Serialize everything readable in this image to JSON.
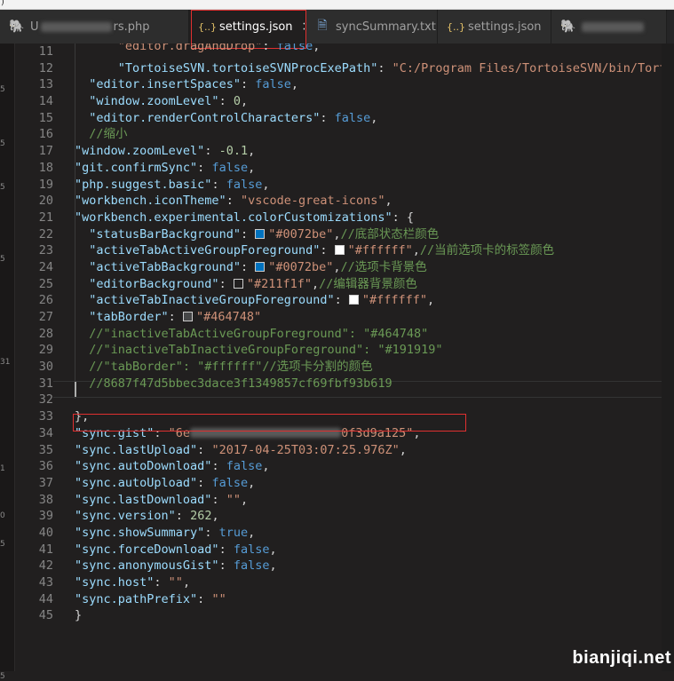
{
  "window": {
    "corner_glyph": ")"
  },
  "tabs": [
    {
      "icon": "php-elephant-icon",
      "label_start": "U",
      "label_end": "rs.php",
      "active": false
    },
    {
      "icon": "json-braces-icon",
      "label": "settings.json",
      "active": true,
      "close": "×"
    },
    {
      "icon": "text-file-icon",
      "label": "syncSummary.txt",
      "active": false
    },
    {
      "icon": "json-braces-icon",
      "label": "settings.json",
      "active": false
    },
    {
      "icon": "php-elephant-icon",
      "label": "",
      "active": false
    }
  ],
  "left_gutter_marks": [
    "5",
    "5",
    "5",
    "5",
    "31",
    "1",
    "0",
    "5",
    "5"
  ],
  "lines": [
    {
      "n": "11",
      "indent": 6,
      "t": [
        [
          "s",
          "\"editor.dragAndDrop\""
        ],
        [
          "p",
          ": "
        ],
        [
          "b",
          "false"
        ],
        [
          "p",
          ","
        ]
      ]
    },
    {
      "n": "12",
      "indent": 6,
      "t": [
        [
          "k",
          "\"TortoiseSVN.tortoiseSVNProcExePath\""
        ],
        [
          "p",
          ": "
        ],
        [
          "s",
          "\"C:/Program Files/TortoiseSVN/bin/Tortoi"
        ]
      ]
    },
    {
      "n": "13",
      "indent": 2,
      "t": [
        [
          "k",
          "\"editor.insertSpaces\""
        ],
        [
          "p",
          ": "
        ],
        [
          "b",
          "false"
        ],
        [
          "p",
          ","
        ]
      ]
    },
    {
      "n": "14",
      "indent": 2,
      "t": [
        [
          "k",
          "\"window.zoomLevel\""
        ],
        [
          "p",
          ": "
        ],
        [
          "n",
          "0"
        ],
        [
          "p",
          ","
        ]
      ]
    },
    {
      "n": "15",
      "indent": 2,
      "t": [
        [
          "k",
          "\"editor.renderControlCharacters\""
        ],
        [
          "p",
          ": "
        ],
        [
          "b",
          "false"
        ],
        [
          "p",
          ","
        ]
      ]
    },
    {
      "n": "16",
      "indent": 2,
      "t": [
        [
          "c",
          "//缩小"
        ]
      ]
    },
    {
      "n": "17",
      "indent": 0,
      "t": [
        [
          "k",
          "\"window.zoomLevel\""
        ],
        [
          "p",
          ": "
        ],
        [
          "n",
          "-0.1"
        ],
        [
          "p",
          ","
        ]
      ]
    },
    {
      "n": "18",
      "indent": 0,
      "t": [
        [
          "k",
          "\"git.confirmSync\""
        ],
        [
          "p",
          ": "
        ],
        [
          "b",
          "false"
        ],
        [
          "p",
          ","
        ]
      ]
    },
    {
      "n": "19",
      "indent": 0,
      "t": [
        [
          "k",
          "\"php.suggest.basic\""
        ],
        [
          "p",
          ": "
        ],
        [
          "b",
          "false"
        ],
        [
          "p",
          ","
        ]
      ]
    },
    {
      "n": "20",
      "indent": 0,
      "t": [
        [
          "k",
          "\"workbench.iconTheme\""
        ],
        [
          "p",
          ": "
        ],
        [
          "s",
          "\"vscode-great-icons\""
        ],
        [
          "p",
          ","
        ]
      ]
    },
    {
      "n": "21",
      "indent": 0,
      "t": [
        [
          "k",
          "\"workbench.experimental.colorCustomizations\""
        ],
        [
          "p",
          ": {"
        ]
      ]
    },
    {
      "n": "22",
      "indent": 2,
      "t": [
        [
          "k",
          "\"statusBarBackground\""
        ],
        [
          "p",
          ": "
        ],
        [
          "sw",
          "#0072be"
        ],
        [
          "s",
          "\"#0072be\""
        ],
        [
          "p",
          ","
        ],
        [
          "c",
          "//底部状态栏颜色"
        ]
      ]
    },
    {
      "n": "23",
      "indent": 2,
      "t": [
        [
          "k",
          "\"activeTabActiveGroupForeground\""
        ],
        [
          "p",
          ": "
        ],
        [
          "sw",
          "#ffffff"
        ],
        [
          "s",
          "\"#ffffff\""
        ],
        [
          "p",
          ","
        ],
        [
          "c",
          "//当前选项卡的标签颜色"
        ]
      ]
    },
    {
      "n": "24",
      "indent": 2,
      "t": [
        [
          "k",
          "\"activeTabBackground\""
        ],
        [
          "p",
          ": "
        ],
        [
          "sw",
          "#0072be"
        ],
        [
          "s",
          "\"#0072be\""
        ],
        [
          "p",
          ","
        ],
        [
          "c",
          "//选项卡背景色"
        ]
      ]
    },
    {
      "n": "25",
      "indent": 2,
      "t": [
        [
          "k",
          "\"editorBackground\""
        ],
        [
          "p",
          ": "
        ],
        [
          "sw",
          "#211f1f"
        ],
        [
          "s",
          "\"#211f1f\""
        ],
        [
          "p",
          ","
        ],
        [
          "c",
          "//编辑器背景颜色"
        ]
      ]
    },
    {
      "n": "26",
      "indent": 2,
      "t": [
        [
          "k",
          "\"activeTabInactiveGroupForeground\""
        ],
        [
          "p",
          ": "
        ],
        [
          "sw",
          "#ffffff"
        ],
        [
          "s",
          "\"#ffffff\""
        ],
        [
          "p",
          ","
        ]
      ]
    },
    {
      "n": "27",
      "indent": 2,
      "t": [
        [
          "k",
          "\"tabBorder\""
        ],
        [
          "p",
          ": "
        ],
        [
          "sw",
          "#464748"
        ],
        [
          "s",
          "\"#464748\""
        ]
      ]
    },
    {
      "n": "28",
      "indent": 2,
      "t": [
        [
          "c",
          "//\"inactiveTabActiveGroupForeground\": \"#464748\""
        ]
      ]
    },
    {
      "n": "29",
      "indent": 2,
      "t": [
        [
          "c",
          "//\"inactiveTabInactiveGroupForeground\": \"#191919\""
        ]
      ]
    },
    {
      "n": "30",
      "indent": 2,
      "t": [
        [
          "c",
          "//\"tabBorder\": \"#ffffff\"//选项卡分割的颜色"
        ]
      ]
    },
    {
      "n": "31",
      "indent": 2,
      "t": [
        [
          "c",
          "//8687f47d5bbec3dace3f1349857cf69fbf93b619"
        ]
      ]
    },
    {
      "n": "32",
      "indent": 0,
      "t": []
    },
    {
      "n": "33",
      "indent": 0,
      "t": [
        [
          "p",
          "},"
        ]
      ]
    },
    {
      "n": "34",
      "indent": 0,
      "t": [
        [
          "k",
          "\"sync.gist\""
        ],
        [
          "p",
          ": "
        ],
        [
          "s",
          "\"6e"
        ],
        [
          "blur",
          "170"
        ],
        [
          "s",
          "0f3d9a125\""
        ],
        [
          "p",
          ","
        ]
      ]
    },
    {
      "n": "35",
      "indent": 0,
      "t": [
        [
          "k",
          "\"sync.lastUpload\""
        ],
        [
          "p",
          ": "
        ],
        [
          "s",
          "\"2017-04-25T03:07:25.976Z\""
        ],
        [
          "p",
          ","
        ]
      ]
    },
    {
      "n": "36",
      "indent": 0,
      "t": [
        [
          "k",
          "\"sync.autoDownload\""
        ],
        [
          "p",
          ": "
        ],
        [
          "b",
          "false"
        ],
        [
          "p",
          ","
        ]
      ]
    },
    {
      "n": "37",
      "indent": 0,
      "t": [
        [
          "k",
          "\"sync.autoUpload\""
        ],
        [
          "p",
          ": "
        ],
        [
          "b",
          "false"
        ],
        [
          "p",
          ","
        ]
      ]
    },
    {
      "n": "38",
      "indent": 0,
      "t": [
        [
          "k",
          "\"sync.lastDownload\""
        ],
        [
          "p",
          ": "
        ],
        [
          "s",
          "\"\""
        ],
        [
          "p",
          ","
        ]
      ]
    },
    {
      "n": "39",
      "indent": 0,
      "t": [
        [
          "k",
          "\"sync.version\""
        ],
        [
          "p",
          ": "
        ],
        [
          "n",
          "262"
        ],
        [
          "p",
          ","
        ]
      ]
    },
    {
      "n": "40",
      "indent": 0,
      "t": [
        [
          "k",
          "\"sync.showSummary\""
        ],
        [
          "p",
          ": "
        ],
        [
          "b",
          "true"
        ],
        [
          "p",
          ","
        ]
      ]
    },
    {
      "n": "41",
      "indent": 0,
      "t": [
        [
          "k",
          "\"sync.forceDownload\""
        ],
        [
          "p",
          ": "
        ],
        [
          "b",
          "false"
        ],
        [
          "p",
          ","
        ]
      ]
    },
    {
      "n": "42",
      "indent": 0,
      "t": [
        [
          "k",
          "\"sync.anonymousGist\""
        ],
        [
          "p",
          ": "
        ],
        [
          "b",
          "false"
        ],
        [
          "p",
          ","
        ]
      ]
    },
    {
      "n": "43",
      "indent": 0,
      "t": [
        [
          "k",
          "\"sync.host\""
        ],
        [
          "p",
          ": "
        ],
        [
          "s",
          "\"\""
        ],
        [
          "p",
          ","
        ]
      ]
    },
    {
      "n": "44",
      "indent": 0,
      "t": [
        [
          "k",
          "\"sync.pathPrefix\""
        ],
        [
          "p",
          ": "
        ],
        [
          "s",
          "\"\""
        ]
      ]
    },
    {
      "n": "45",
      "indent": 0,
      "t": [
        [
          "p",
          "}"
        ]
      ]
    }
  ],
  "watermark": "bianjiqi.net",
  "colors": {
    "editor_bg": "#211f1f",
    "highlight_box": "#e03030"
  }
}
